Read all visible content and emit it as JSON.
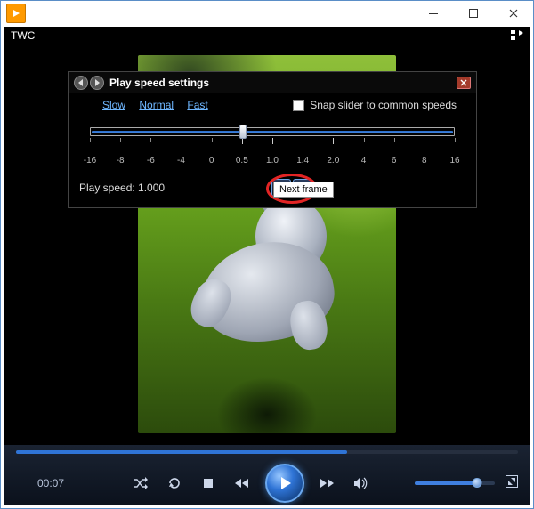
{
  "title": " ",
  "twc": "TWC",
  "panel": {
    "title": "Play speed settings",
    "links": {
      "slow": "Slow",
      "normal": "Normal",
      "fast": "Fast"
    },
    "snap_label": "Snap slider to common speeds",
    "readout": "Play speed: 1.000",
    "tooltip": "Next frame",
    "slider_value_pct": 42,
    "ticks": [
      "-16",
      "-8",
      "-6",
      "-4",
      "0",
      "0.5",
      "1.0",
      "1.4",
      "2.0",
      "4",
      "6",
      "8",
      "16"
    ]
  },
  "controls": {
    "time": "00:07",
    "seek_pct": 66,
    "vol_pct": 78
  }
}
